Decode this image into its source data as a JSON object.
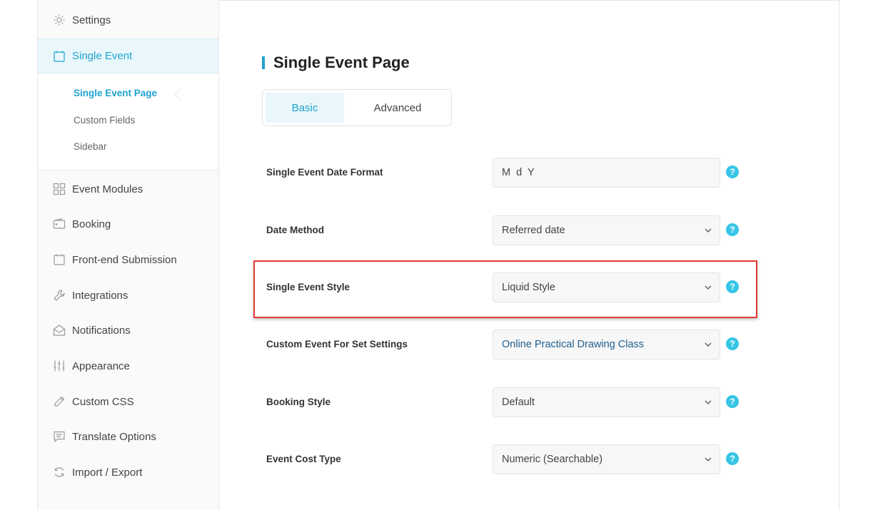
{
  "sidebar": {
    "items": [
      {
        "label": "Settings",
        "icon": "gear-icon"
      },
      {
        "label": "Single Event",
        "icon": "calendar-icon",
        "active": true
      },
      {
        "label": "Event Modules",
        "icon": "grid-icon"
      },
      {
        "label": "Booking",
        "icon": "wallet-icon"
      },
      {
        "label": "Front-end Submission",
        "icon": "calendar-icon"
      },
      {
        "label": "Integrations",
        "icon": "wrench-icon"
      },
      {
        "label": "Notifications",
        "icon": "envelope-icon"
      },
      {
        "label": "Appearance",
        "icon": "sliders-icon"
      },
      {
        "label": "Custom CSS",
        "icon": "pencil-icon"
      },
      {
        "label": "Translate Options",
        "icon": "message-icon"
      },
      {
        "label": "Import / Export",
        "icon": "refresh-icon"
      }
    ],
    "submenu": [
      {
        "label": "Single Event Page",
        "active": true
      },
      {
        "label": "Custom Fields"
      },
      {
        "label": "Sidebar"
      }
    ]
  },
  "main": {
    "title": "Single Event Page",
    "tabs": [
      {
        "label": "Basic",
        "active": true
      },
      {
        "label": "Advanced"
      }
    ],
    "rows": [
      {
        "label": "Single Event Date Format",
        "value": "M d Y",
        "type": "text"
      },
      {
        "label": "Date Method",
        "value": "Referred date",
        "type": "select"
      },
      {
        "label": "Single Event Style",
        "value": "Liquid Style",
        "type": "select",
        "highlighted": true
      },
      {
        "label": "Custom Event For Set Settings",
        "value": "Online Practical Drawing Class",
        "type": "select"
      },
      {
        "label": "Booking Style",
        "value": "Default",
        "type": "select"
      },
      {
        "label": "Event Cost Type",
        "value": "Numeric (Searchable)",
        "type": "select"
      }
    ],
    "help_glyph": "?"
  },
  "colors": {
    "accent": "#1fa3cf",
    "active_bg": "#e9f7fb",
    "help_bg": "#37c5e6",
    "highlight": "#e53935"
  }
}
